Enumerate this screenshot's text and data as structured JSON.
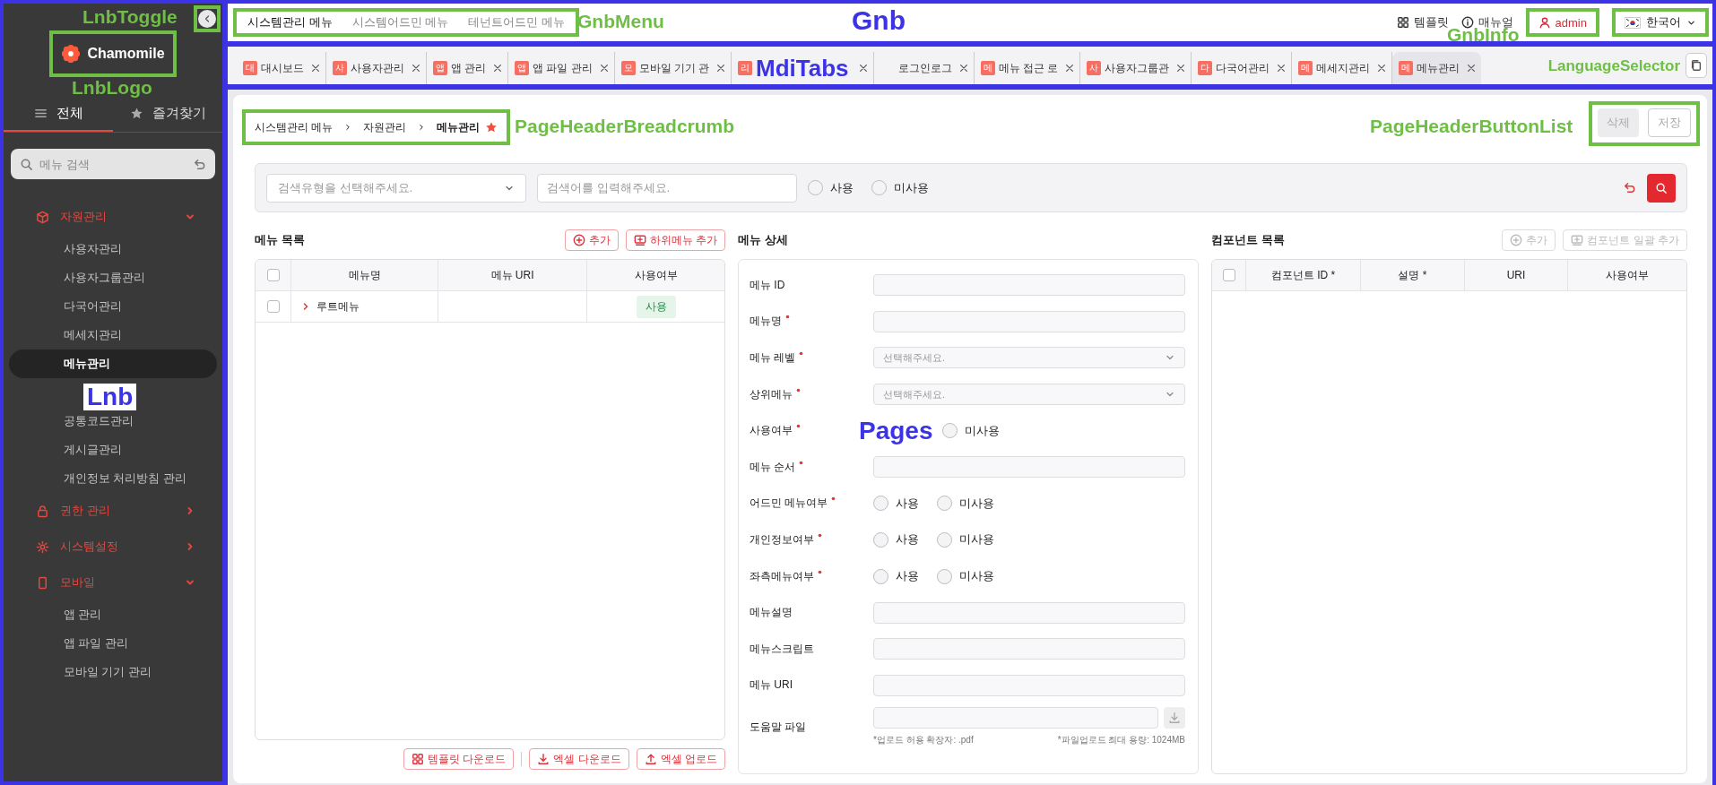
{
  "lnb": {
    "logo": "Chamomile",
    "tabs": [
      {
        "label": "전체",
        "selected": true
      },
      {
        "label": "즐겨찾기",
        "selected": false
      }
    ],
    "search": {
      "placeholder": "메뉴 검색"
    },
    "menu": [
      {
        "label": "자원관리",
        "expanded": true,
        "children": [
          {
            "label": "사용자관리",
            "selected": false
          },
          {
            "label": "사용자그룹관리",
            "selected": false
          },
          {
            "label": "다국어관리",
            "selected": false
          },
          {
            "label": "메세지관리",
            "selected": false
          },
          {
            "label": "메뉴관리",
            "selected": true
          },
          {
            "kind": "covered"
          },
          {
            "label": "공통코드관리",
            "selected": false
          },
          {
            "label": "게시글관리",
            "selected": false
          },
          {
            "label": "개인정보 처리방침 관리",
            "selected": false
          }
        ]
      },
      {
        "label": "권한 관리",
        "expanded": false
      },
      {
        "label": "시스템설정",
        "expanded": false
      },
      {
        "label": "모바일",
        "expanded": true,
        "children": [
          {
            "label": "앱 관리",
            "selected": false
          },
          {
            "label": "앱 파일 관리",
            "selected": false
          },
          {
            "label": "모바일 기기 관리",
            "selected": false
          }
        ]
      }
    ]
  },
  "gnb": {
    "menus": [
      {
        "label": "시스템관리 메뉴",
        "selected": true
      },
      {
        "label": "시스템어드민 메뉴",
        "selected": false
      },
      {
        "label": "테넌트어드민 메뉴",
        "selected": false
      }
    ],
    "links": [
      "템플릿",
      "매뉴얼"
    ],
    "user": "admin",
    "language": "한국어"
  },
  "mdi_tabs": [
    {
      "badge": "대",
      "label": "대시보드",
      "selected": false
    },
    {
      "badge": "사",
      "label": "사용자관리",
      "selected": false
    },
    {
      "badge": "앱",
      "label": "앱 관리",
      "selected": false
    },
    {
      "badge": "앱",
      "label": "앱 파일 관리",
      "selected": false
    },
    {
      "badge": "모",
      "label": "모바일 기기 관",
      "selected": false
    },
    {
      "badge": "리",
      "selected": false
    },
    {
      "label": "로그인로그",
      "selected": false
    },
    {
      "badge": "메",
      "label": "메뉴 접근 로",
      "selected": false
    },
    {
      "badge": "사",
      "label": "사용자그룹관",
      "selected": false
    },
    {
      "badge": "다",
      "label": "다국어관리",
      "selected": false
    },
    {
      "badge": "메",
      "label": "메세지관리",
      "selected": false
    },
    {
      "badge": "메",
      "label": "메뉴관리",
      "selected": true
    }
  ],
  "page_header": {
    "breadcrumb": [
      "시스템관리 메뉴",
      "자원관리",
      "메뉴관리"
    ],
    "favorite": true,
    "buttons": [
      {
        "label": "삭제",
        "kind": "filled"
      },
      {
        "label": "저장",
        "kind": "outline"
      }
    ]
  },
  "search": {
    "type_select": {
      "placeholder": "검색유형을 선택해주세요."
    },
    "keyword": {
      "placeholder": "검색어를 입력해주세요."
    },
    "options": [
      {
        "label": "사용",
        "selected": false
      },
      {
        "label": "미사용",
        "selected": false
      }
    ]
  },
  "menu_list": {
    "title": "메뉴 목록",
    "actions": [
      {
        "label": "추가",
        "disabled": false
      },
      {
        "label": "하위메뉴 추가",
        "disabled": false
      }
    ],
    "header_checked": false,
    "columns": [
      "메뉴명",
      "메뉴 URI",
      "사용여부"
    ],
    "rows": [
      {
        "checked": false,
        "expanded": false,
        "name": "루트메뉴",
        "use": "사용"
      }
    ],
    "footer_buttons": [
      "템플릿 다운로드",
      "엑셀 다운로드",
      "엑셀 업로드"
    ]
  },
  "menu_detail": {
    "title": "메뉴 상세",
    "fields": [
      {
        "kind": "text",
        "label": "메뉴 ID",
        "required": false
      },
      {
        "kind": "text",
        "label": "메뉴명",
        "required": true
      },
      {
        "kind": "select",
        "label": "메뉴 레벨",
        "required": true,
        "placeholder": "선택해주세요."
      },
      {
        "kind": "select",
        "label": "상위메뉴",
        "required": true,
        "placeholder": "선택해주세요."
      },
      {
        "kind": "radio",
        "label": "사용여부",
        "required": true,
        "options": [
          {
            "label": "미사용",
            "selected": false
          }
        ]
      },
      {
        "kind": "text",
        "label": "메뉴 순서",
        "required": true
      },
      {
        "kind": "radio",
        "label": "어드민 메뉴여부",
        "required": true,
        "options": [
          {
            "label": "사용",
            "selected": false
          },
          {
            "label": "미사용",
            "selected": false
          }
        ]
      },
      {
        "kind": "radio",
        "label": "개인정보여부",
        "required": true,
        "options": [
          {
            "label": "사용",
            "selected": false
          },
          {
            "label": "미사용",
            "selected": false
          }
        ]
      },
      {
        "kind": "radio",
        "label": "좌측메뉴여부",
        "required": true,
        "options": [
          {
            "label": "사용",
            "selected": false
          },
          {
            "label": "미사용",
            "selected": false
          }
        ]
      },
      {
        "kind": "text",
        "label": "메뉴설명",
        "required": false
      },
      {
        "kind": "text",
        "label": "메뉴스크립트",
        "required": false
      },
      {
        "kind": "text",
        "label": "메뉴 URI",
        "required": false
      },
      {
        "kind": "file",
        "label": "도움말 파일",
        "required": false,
        "hints": [
          "*업로드 허용 확장자: .pdf",
          "*파일업로드 최대 용량: 1024MB"
        ]
      }
    ]
  },
  "component_list": {
    "title": "컴포넌트 목록",
    "actions": [
      {
        "label": "추가",
        "disabled": true
      },
      {
        "label": "컴포넌트 일괄 추가",
        "disabled": true
      }
    ],
    "header_checked": false,
    "columns": [
      "컴포넌트 ID *",
      "설명 *",
      "URI",
      "사용여부"
    ]
  },
  "annotations": [
    {
      "label": "LnbToggle",
      "kind": "component"
    },
    {
      "label": "LnbLogo",
      "kind": "component"
    },
    {
      "label": "Lnb",
      "kind": "region"
    },
    {
      "label": "GnbMenu",
      "kind": "component"
    },
    {
      "label": "Gnb",
      "kind": "region"
    },
    {
      "label": "GnbInfo",
      "kind": "component"
    },
    {
      "label": "MdiTabs",
      "kind": "region"
    },
    {
      "label": "LanguageSelector",
      "kind": "component"
    },
    {
      "label": "PageHeaderBreadcrumb",
      "kind": "component"
    },
    {
      "label": "PageHeaderButtonList",
      "kind": "component"
    },
    {
      "label": "Pages",
      "kind": "region"
    }
  ]
}
